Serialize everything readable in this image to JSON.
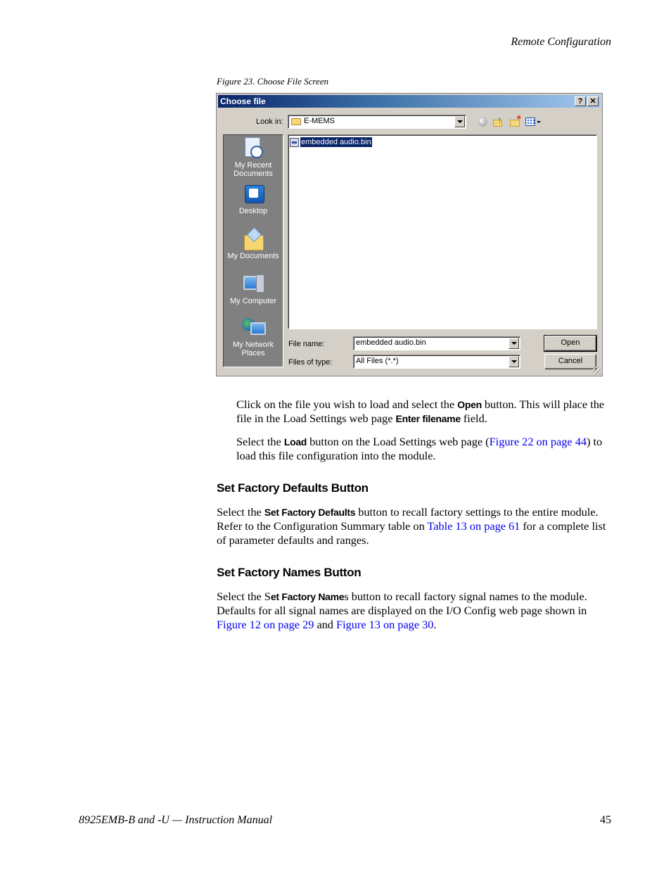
{
  "running_head": "Remote Configuration",
  "figure_caption": "Figure 23.  Choose File Screen",
  "dialog": {
    "title": "Choose file",
    "help_button": "?",
    "close_button": "✕",
    "look_in_label": "Look in:",
    "look_in_value": "E-MEMS",
    "toolbar_icons": [
      "back-icon",
      "up-folder-icon",
      "new-folder-icon",
      "views-menu-icon"
    ],
    "places": [
      {
        "label": "My Recent Documents",
        "icon": "recent-documents-icon"
      },
      {
        "label": "Desktop",
        "icon": "desktop-icon"
      },
      {
        "label": "My Documents",
        "icon": "my-documents-icon"
      },
      {
        "label": "My Computer",
        "icon": "my-computer-icon"
      },
      {
        "label": "My Network Places",
        "icon": "network-places-icon"
      }
    ],
    "files": [
      {
        "name": "embedded audio.bin",
        "selected": true
      }
    ],
    "file_name_label": "File name:",
    "file_name_value": "embedded audio.bin",
    "files_of_type_label": "Files of type:",
    "files_of_type_value": "All Files (*.*)",
    "open_button": "Open",
    "cancel_button": "Cancel"
  },
  "body": {
    "p1": {
      "t1": "Click on the file you wish to load and select the ",
      "b1": "Open",
      "t2": " button. This will place the file in the Load Settings web page ",
      "b2": "Enter filename",
      "t3": " field."
    },
    "p2": {
      "t1": "Select the ",
      "b1": "Load",
      "t2": " button on the Load Settings web page (",
      "link1": "Figure 22 on page 44",
      "t3": ") to load this file configuration into the module."
    },
    "heading1": "Set Factory Defaults Button",
    "p3": {
      "t1": "Select the ",
      "b1": "Set Factory Defaults",
      "t2": " button to recall factory settings to the entire module. Refer to the Configuration Summary table on ",
      "link1": "Table 13 on page 61",
      "t3": " for a complete list of parameter defaults and ranges."
    },
    "heading2": "Set Factory Names Button",
    "p4": {
      "t1": "Select the S",
      "b1": "et Factory Name",
      "t2": "s button to recall factory signal names to the module. Defaults for all signal names are displayed on the I/O Config web page shown in ",
      "link1": "Figure 12 on page 29",
      "t3": " and ",
      "link2": "Figure 13 on page 30",
      "t4": "."
    }
  },
  "footer": {
    "manual_title": "8925EMB-B and -U — Instruction Manual",
    "page_number": "45"
  },
  "colors": {
    "link": "#0000ee",
    "titlebar_start": "#0a246a",
    "titlebar_end": "#a6caf0",
    "selection": "#0a246a",
    "dialog_face": "#d4d0c8",
    "places_bar": "#808080"
  }
}
